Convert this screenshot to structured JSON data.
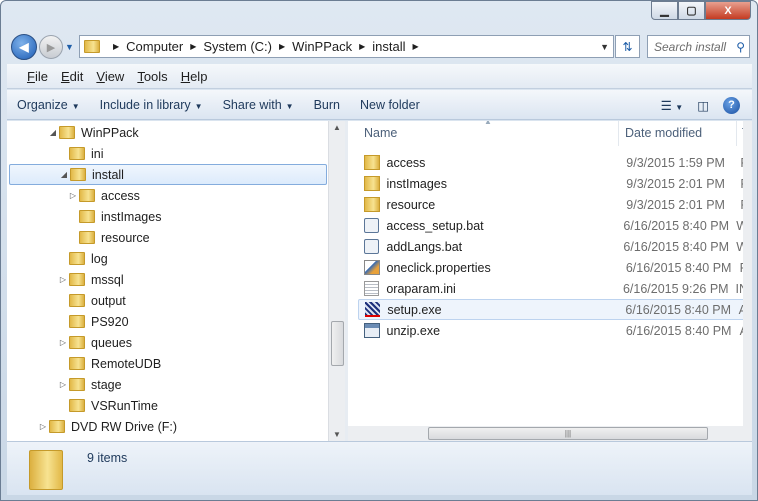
{
  "window": {
    "minimize": "▁",
    "maximize": "▢",
    "close": "X"
  },
  "address": {
    "crumbs": [
      "Computer",
      "System (C:)",
      "WinPPack",
      "install"
    ]
  },
  "search": {
    "placeholder": "Search install"
  },
  "menu": [
    "File",
    "Edit",
    "View",
    "Tools",
    "Help"
  ],
  "commands": {
    "organize": "Organize",
    "include": "Include in library",
    "share": "Share with",
    "burn": "Burn",
    "new_folder": "New folder"
  },
  "tree": [
    {
      "label": "WinPPack",
      "level": 1,
      "exp": "◢"
    },
    {
      "label": "ini",
      "level": 2,
      "exp": ""
    },
    {
      "label": "install",
      "level": 2,
      "exp": "◢",
      "selected": true
    },
    {
      "label": "access",
      "level": 3,
      "exp": "▷"
    },
    {
      "label": "instImages",
      "level": 3,
      "exp": ""
    },
    {
      "label": "resource",
      "level": 3,
      "exp": ""
    },
    {
      "label": "log",
      "level": 2,
      "exp": ""
    },
    {
      "label": "mssql",
      "level": 2,
      "exp": "▷"
    },
    {
      "label": "output",
      "level": 2,
      "exp": ""
    },
    {
      "label": "PS920",
      "level": 2,
      "exp": ""
    },
    {
      "label": "queues",
      "level": 2,
      "exp": "▷"
    },
    {
      "label": "RemoteUDB",
      "level": 2,
      "exp": ""
    },
    {
      "label": "stage",
      "level": 2,
      "exp": "▷"
    },
    {
      "label": "VSRunTime",
      "level": 2,
      "exp": ""
    },
    {
      "label": "DVD RW Drive (F:)",
      "level": 0,
      "exp": "▷"
    }
  ],
  "columns": {
    "name": "Name",
    "date": "Date modified",
    "type": "T"
  },
  "files": [
    {
      "name": "access",
      "date": "9/3/2015 1:59 PM",
      "type": "F",
      "icon": "folder"
    },
    {
      "name": "instImages",
      "date": "9/3/2015 2:01 PM",
      "type": "F",
      "icon": "folder"
    },
    {
      "name": "resource",
      "date": "9/3/2015 2:01 PM",
      "type": "F",
      "icon": "folder"
    },
    {
      "name": "access_setup.bat",
      "date": "6/16/2015 8:40 PM",
      "type": "W",
      "icon": "bat"
    },
    {
      "name": "addLangs.bat",
      "date": "6/16/2015 8:40 PM",
      "type": "W",
      "icon": "bat"
    },
    {
      "name": "oneclick.properties",
      "date": "6/16/2015 8:40 PM",
      "type": "P",
      "icon": "prop"
    },
    {
      "name": "oraparam.ini",
      "date": "6/16/2015 9:26 PM",
      "type": "IN",
      "icon": "ini"
    },
    {
      "name": "setup.exe",
      "date": "6/16/2015 8:40 PM",
      "type": "A",
      "icon": "exe1",
      "highlight": true
    },
    {
      "name": "unzip.exe",
      "date": "6/16/2015 8:40 PM",
      "type": "A",
      "icon": "exe2"
    }
  ],
  "status": {
    "count": "9 items"
  }
}
